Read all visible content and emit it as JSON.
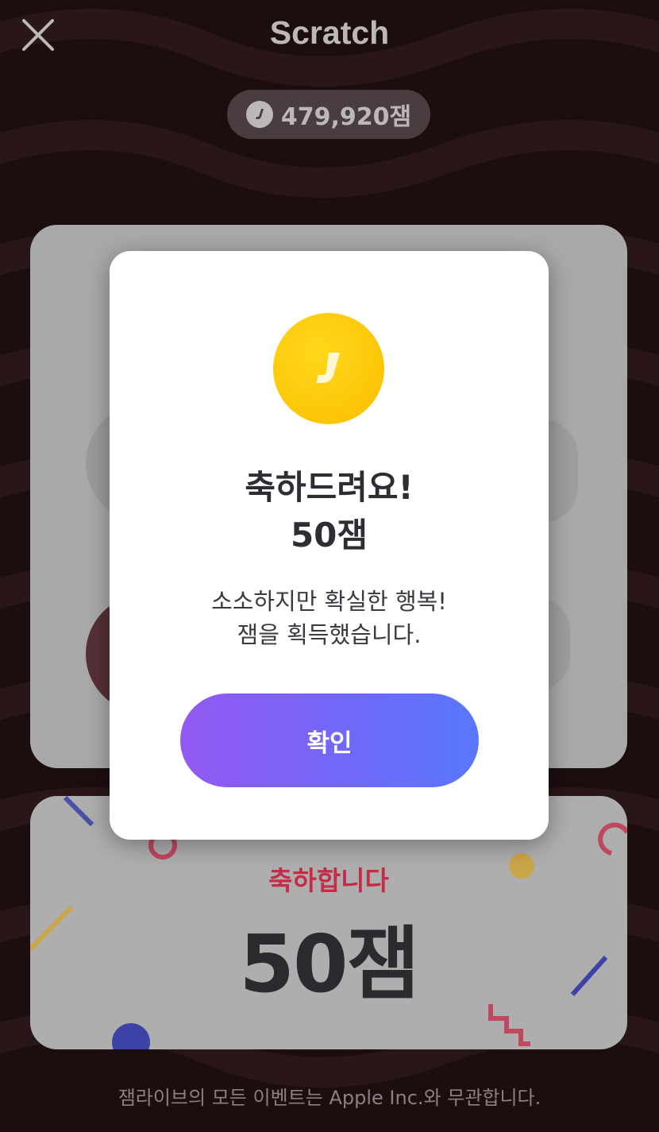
{
  "header": {
    "title": "Scratch",
    "close_icon": "close-icon"
  },
  "balance": {
    "icon": "jam-coin-icon",
    "amount": "479,920잼"
  },
  "card": {
    "prize_label": "축하합니다",
    "prize_amount": "50잼"
  },
  "modal": {
    "icon": "jam-coin-icon",
    "coin_letter": "J",
    "title_line1": "축하드려요!",
    "title_line2": "50잼",
    "message_line1": "소소하지만 확실한 행복!",
    "message_line2": "잼을 획득했습니다.",
    "confirm_label": "확인"
  },
  "footer": {
    "note": "잼라이브의 모든 이벤트는 Apple Inc.와 무관합니다."
  },
  "colors": {
    "background": "#1c0d0f",
    "coin": "#fcc800",
    "button_gradient_start": "#9359f2",
    "button_gradient_end": "#5877fd",
    "prize_label": "#c72b47"
  }
}
